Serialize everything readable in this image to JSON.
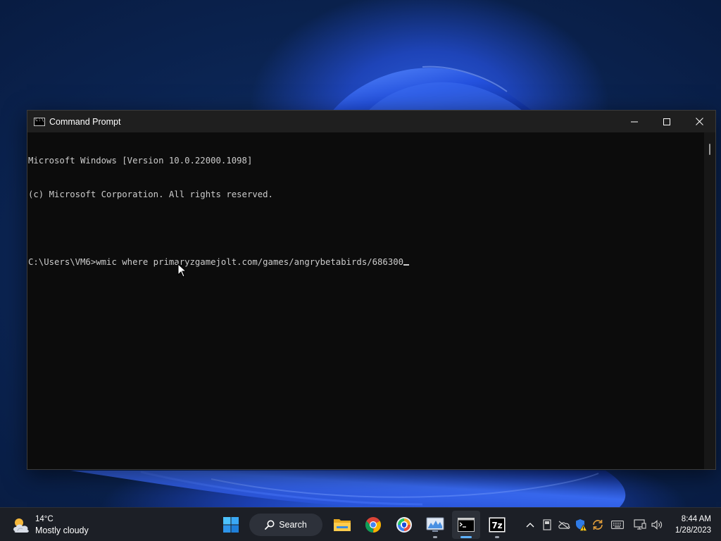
{
  "window": {
    "title": "Command Prompt",
    "icon": "cmd-icon"
  },
  "console": {
    "lines": [
      "Microsoft Windows [Version 10.0.22000.1098]",
      "(c) Microsoft Corporation. All rights reserved.",
      "",
      "C:\\Users\\VM6>wmic where primaryzgamejolt.com/games/angrybetabirds/686300"
    ]
  },
  "taskbar": {
    "weather": {
      "temperature": "14°C",
      "condition": "Mostly cloudy",
      "icon": "partly-cloudy-icon"
    },
    "search_label": "Search",
    "apps": [
      {
        "name": "start",
        "icon": "windows-logo-icon"
      },
      {
        "name": "search",
        "icon": "search-icon"
      },
      {
        "name": "file-explorer",
        "icon": "folder-icon"
      },
      {
        "name": "chrome",
        "icon": "chrome-icon"
      },
      {
        "name": "app-shield",
        "icon": "shield-app-icon"
      },
      {
        "name": "performance-monitor",
        "icon": "performance-monitor-icon"
      },
      {
        "name": "command-prompt",
        "icon": "terminal-icon",
        "active": true
      },
      {
        "name": "7zip",
        "icon": "7zip-icon",
        "label": "7z"
      }
    ],
    "clock": {
      "time": "8:44 AM",
      "date": "1/28/2023"
    }
  },
  "colors": {
    "console_bg": "#0c0c0c",
    "console_text": "#cccccc",
    "titlebar_bg": "#1f1f1f",
    "taskbar_bg": "#1c1f26",
    "accent": "#5fb2ff"
  }
}
